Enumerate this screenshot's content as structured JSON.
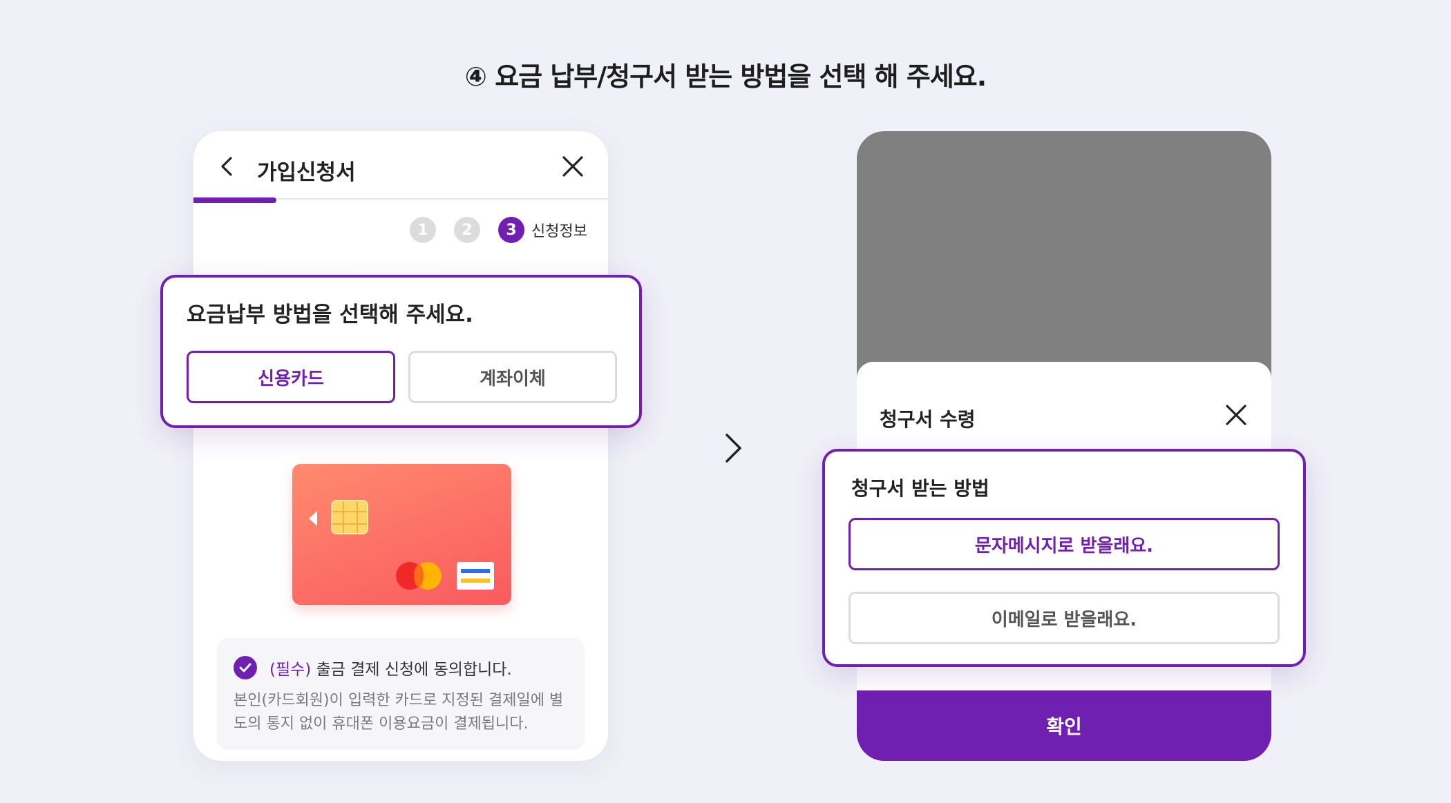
{
  "headline": "④ 요금 납부/청구서 받는 방법을 선택 해 주세요.",
  "left_screen": {
    "title": "가입신청서",
    "steps": [
      "1",
      "2",
      "3"
    ],
    "active_step_label": "신청정보",
    "payment_popup": {
      "title": "요금납부 방법을 선택해 주세요.",
      "options": [
        {
          "label": "신용카드",
          "selected": true
        },
        {
          "label": "계좌이체",
          "selected": false
        }
      ]
    },
    "agreement": {
      "required_tag": "(필수)",
      "text": " 출금 결제 신청에 동의합니다.",
      "description": "본인(카드회원)이 입력한 카드로 지정된 결제일에 별도의 통지 없이 휴대폰 이용요금이 결제됩니다."
    }
  },
  "right_screen": {
    "sheet_title": "청구서 수령",
    "bill_popup": {
      "title": "청구서 받는 방법",
      "options": [
        {
          "label": "문자메시지로 받을래요.",
          "selected": true
        },
        {
          "label": "이메일로 받을래요.",
          "selected": false
        }
      ]
    },
    "confirm_label": "확인"
  },
  "colors": {
    "accent": "#7020b0",
    "background": "#f0f0f8",
    "dim_overlay": "#808080",
    "card_gradient_start": "#ff8a6e",
    "card_gradient_end": "#fa5a5f"
  },
  "icons": {
    "back": "chevron-left-icon",
    "close": "close-icon",
    "check": "check-circle-icon",
    "between": "chevron-right-icon"
  }
}
